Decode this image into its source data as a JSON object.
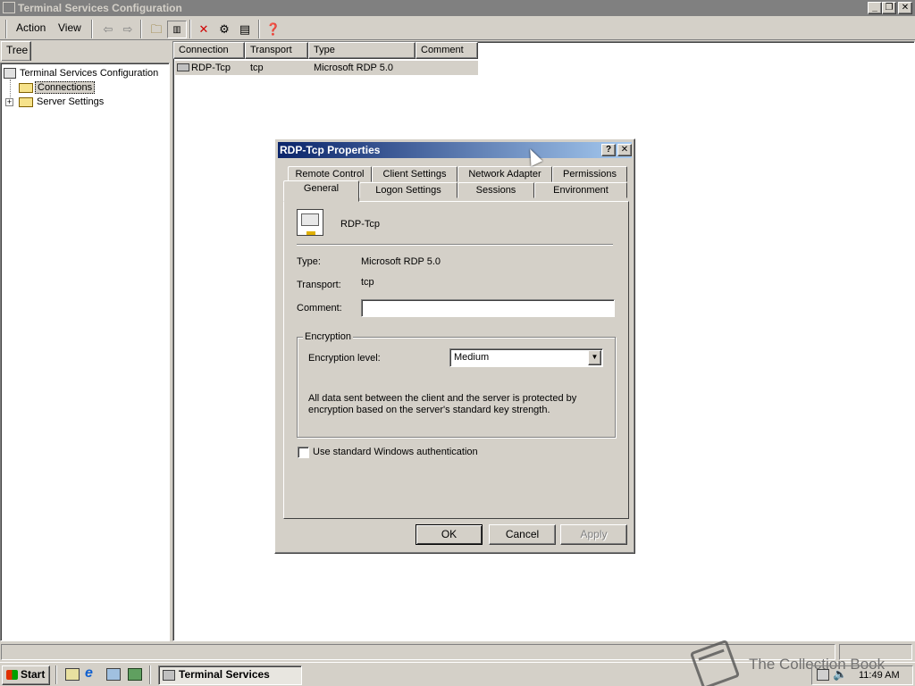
{
  "window": {
    "title": "Terminal Services Configuration"
  },
  "menu": {
    "action": "Action",
    "view": "View"
  },
  "left_pane": {
    "tab": "Tree",
    "root": "Terminal Services Configuration",
    "items": [
      {
        "label": "Connections"
      },
      {
        "label": "Server Settings"
      }
    ]
  },
  "list": {
    "headers": [
      "Connection",
      "Transport",
      "Type",
      "Comment"
    ],
    "rows": [
      {
        "connection": "RDP-Tcp",
        "transport": "tcp",
        "type": "Microsoft RDP 5.0",
        "comment": ""
      }
    ]
  },
  "dialog": {
    "title": "RDP-Tcp Properties",
    "help": "?",
    "tabs_back": [
      "Remote Control",
      "Client Settings",
      "Network Adapter",
      "Permissions"
    ],
    "tabs_front": [
      "General",
      "Logon Settings",
      "Sessions",
      "Environment"
    ],
    "active_tab": "General",
    "name": "RDP-Tcp",
    "type_label": "Type:",
    "type_value": "Microsoft RDP 5.0",
    "transport_label": "Transport:",
    "transport_value": "tcp",
    "comment_label": "Comment:",
    "comment_value": "",
    "encryption_group": "Encryption",
    "encryption_label": "Encryption level:",
    "encryption_value": "Medium",
    "encryption_desc_1": "All data sent between the client and the server is protected by",
    "encryption_desc_2": "encryption based on the server's standard key strength.",
    "auth_checkbox": "Use standard Windows authentication",
    "auth_checked": false,
    "ok": "OK",
    "cancel": "Cancel",
    "apply": "Apply"
  },
  "taskbar": {
    "start": "Start",
    "task": "Terminal Services Con...",
    "clock": "11:49 AM",
    "watermark": "The Collection Book"
  },
  "colors": {
    "title_active_start": "#0a246a",
    "title_active_end": "#a6caf0",
    "inactive_title": "#808080",
    "face": "#d4d0c8"
  }
}
